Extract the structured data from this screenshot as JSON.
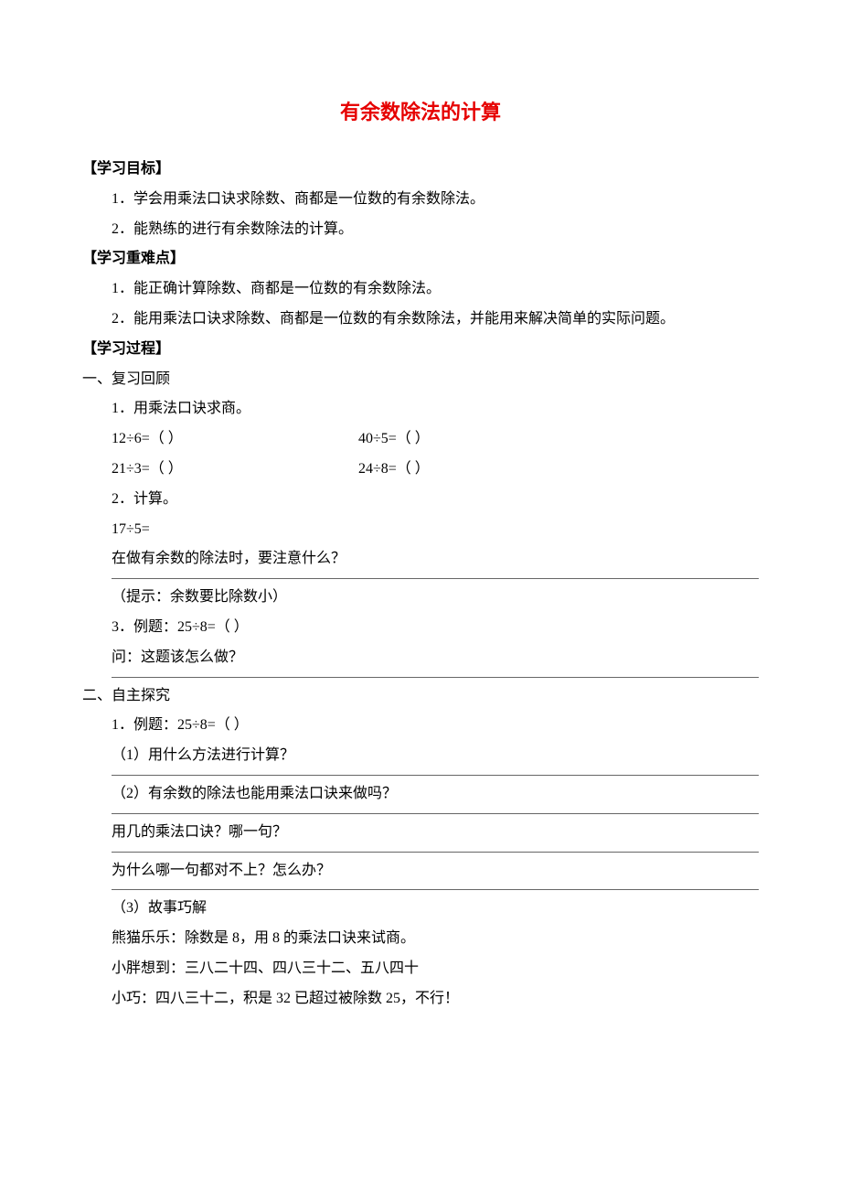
{
  "title": "有余数除法的计算",
  "s1": {
    "heading": "【学习目标】",
    "items": [
      "1．学会用乘法口诀求除数、商都是一位数的有余数除法。",
      "2．能熟练的进行有余数除法的计算。"
    ]
  },
  "s2": {
    "heading": "【学习重难点】",
    "items": [
      "1．能正确计算除数、商都是一位数的有余数除法。",
      "2．能用乘法口诀求除数、商都是一位数的有余数除法，并能用来解决简单的实际问题。"
    ]
  },
  "s3": {
    "heading": "【学习过程】"
  },
  "p1": {
    "heading": "一、复习回顾",
    "line1": "1．用乘法口诀求商。",
    "row1a": "12÷6=（     ）",
    "row1b": "40÷5=（     ）",
    "row2a": "21÷3=（     ）",
    "row2b": "24÷8=（     ）",
    "line2": "2．计算。",
    "line3": "17÷5=",
    "q1": "在做有余数的除法时，要注意什么？",
    "hint": "（提示：余数要比除数小）",
    "line4": "3．例题：25÷8=（          ）",
    "q2": "问：这题该怎么做？"
  },
  "p2": {
    "heading": "二、自主探究",
    "line1": "1．例题：25÷8=（     ）",
    "q1": "（1）用什么方法进行计算？",
    "q2": "（2）有余数的除法也能用乘法口诀来做吗？",
    "q3": "用几的乘法口诀？哪一句？",
    "q4": "为什么哪一句都对不上？怎么办？",
    "s3": "（3）故事巧解",
    "l1": "熊猫乐乐：除数是 8，用 8 的乘法口诀来试商。",
    "l2": "小胖想到：三八二十四、四八三十二、五八四十",
    "l3": "小巧：四八三十二，积是 32 已超过被除数 25，不行！"
  }
}
